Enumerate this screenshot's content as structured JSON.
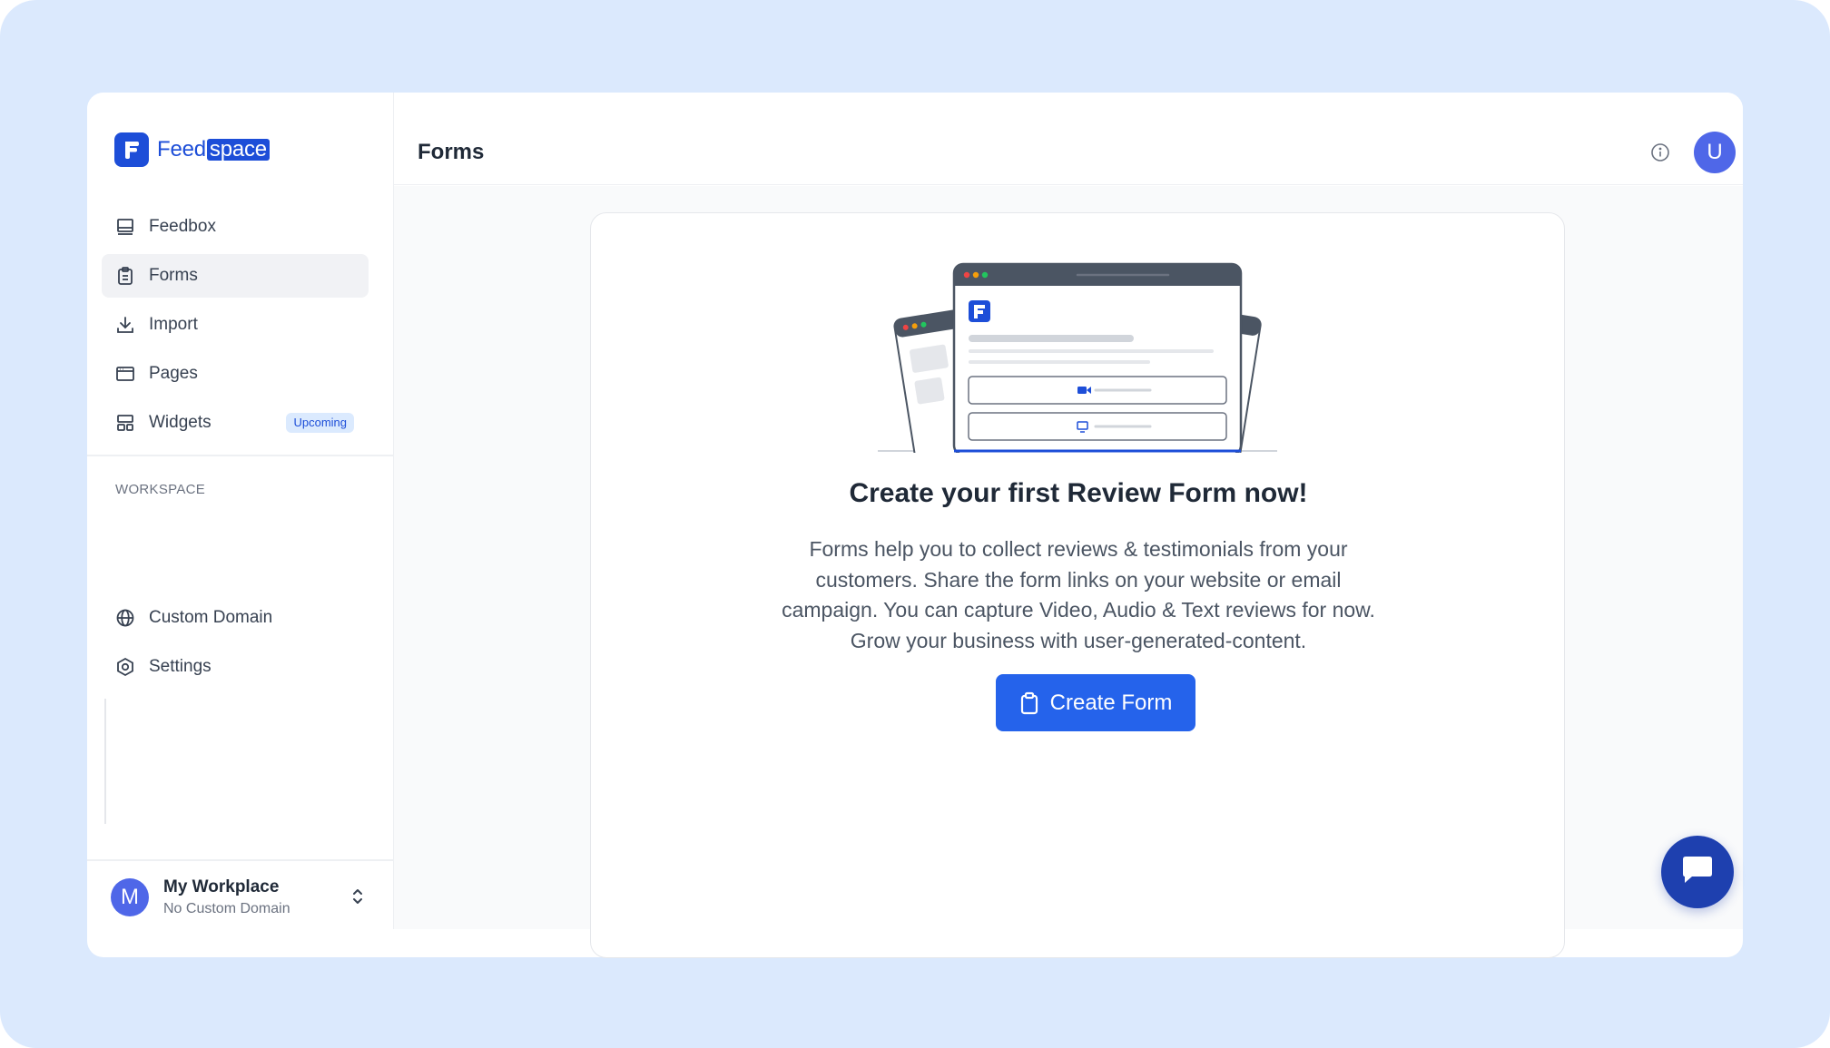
{
  "brand": {
    "name_part1": "Feed",
    "name_part2": "space",
    "accent": "#1d4ed8"
  },
  "sidebar": {
    "items": [
      {
        "label": "Feedbox",
        "icon": "inbox-icon"
      },
      {
        "label": "Forms",
        "icon": "clipboard-icon",
        "active": true
      },
      {
        "label": "Import",
        "icon": "download-icon"
      },
      {
        "label": "Pages",
        "icon": "browser-window-icon"
      },
      {
        "label": "Widgets",
        "icon": "layout-grid-icon",
        "badge": "Upcoming"
      }
    ],
    "workspace_label": "WORKSPACE",
    "workspace_items": [
      {
        "label": "Custom Domain",
        "icon": "globe-icon"
      },
      {
        "label": "Settings",
        "icon": "gear-icon"
      }
    ],
    "workspace_switcher": {
      "avatar_letter": "M",
      "name": "My Workplace",
      "subtitle": "No Custom Domain"
    }
  },
  "header": {
    "title": "Forms",
    "user_avatar_letter": "U"
  },
  "empty_state": {
    "headline": "Create your first Review Form now!",
    "description": "Forms help you to collect reviews & testimonials from your customers. Share the form links on your website or email campaign. You can capture Video, Audio & Text reviews for now. Grow your business with user-generated-content.",
    "button_label": "Create Form"
  }
}
